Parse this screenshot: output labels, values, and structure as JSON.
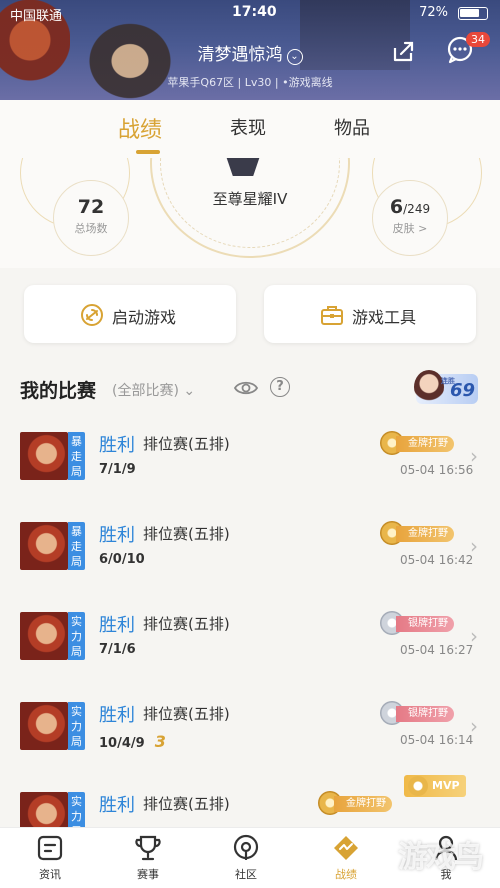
{
  "status_bar": {
    "carrier": "中国联通",
    "time": "17:40",
    "battery": "72%"
  },
  "profile": {
    "name": "清梦遇惊鸿",
    "server_info": "苹果手Q67区 | Lv30 | •游戏离线",
    "notification_count": "34"
  },
  "tabs": [
    {
      "label": "战绩",
      "active": true
    },
    {
      "label": "表现",
      "active": false
    },
    {
      "label": "物品",
      "active": false
    }
  ],
  "summary": {
    "rank": "至尊星耀IV",
    "total_games": "72",
    "total_games_label": "总场数",
    "skins_owned": "6",
    "skins_total": "/249",
    "skins_label": "皮肤 >"
  },
  "actions": {
    "launch_game": "启动游戏",
    "game_tools": "游戏工具"
  },
  "matches_header": {
    "title": "我的比赛",
    "filter": "(全部比赛)",
    "streak_label": "连胜",
    "streak_value": "69"
  },
  "matches": [
    {
      "mode": "暴走局",
      "result": "胜利",
      "type": "排位赛(五排)",
      "kda": "7/1/9",
      "medal": "金牌打野",
      "medal_kind": "gold",
      "time": "05-04 16:56"
    },
    {
      "mode": "暴走局",
      "result": "胜利",
      "type": "排位赛(五排)",
      "kda": "6/0/10",
      "medal": "金牌打野",
      "medal_kind": "gold",
      "time": "05-04 16:42"
    },
    {
      "mode": "实力局",
      "result": "胜利",
      "type": "排位赛(五排)",
      "kda": "7/1/6",
      "medal": "银牌打野",
      "medal_kind": "silver",
      "time": "05-04 16:27"
    },
    {
      "mode": "实力局",
      "result": "胜利",
      "type": "排位赛(五排)",
      "kda": "10/4/9",
      "multikill": "3",
      "medal": "银牌打野",
      "medal_kind": "silver",
      "time": "05-04 16:14"
    },
    {
      "mode": "实力局",
      "result": "胜利",
      "type": "排位赛(五排)",
      "kda": "",
      "medal": "金牌打野",
      "medal_kind": "gold",
      "extra_badge": "MVP",
      "time": ""
    }
  ],
  "bottom_nav": [
    {
      "label": "资讯",
      "icon": "news-icon"
    },
    {
      "label": "赛事",
      "icon": "trophy-icon"
    },
    {
      "label": "社区",
      "icon": "community-icon"
    },
    {
      "label": "战绩",
      "icon": "record-icon",
      "active": true
    },
    {
      "label": "我",
      "icon": "profile-icon"
    }
  ],
  "watermark": "游戏鸟",
  "colors": {
    "accent": "#d8a334",
    "win": "#2e85d8",
    "mode_tag": "#3c8ee2",
    "badge": "#e8483a"
  }
}
